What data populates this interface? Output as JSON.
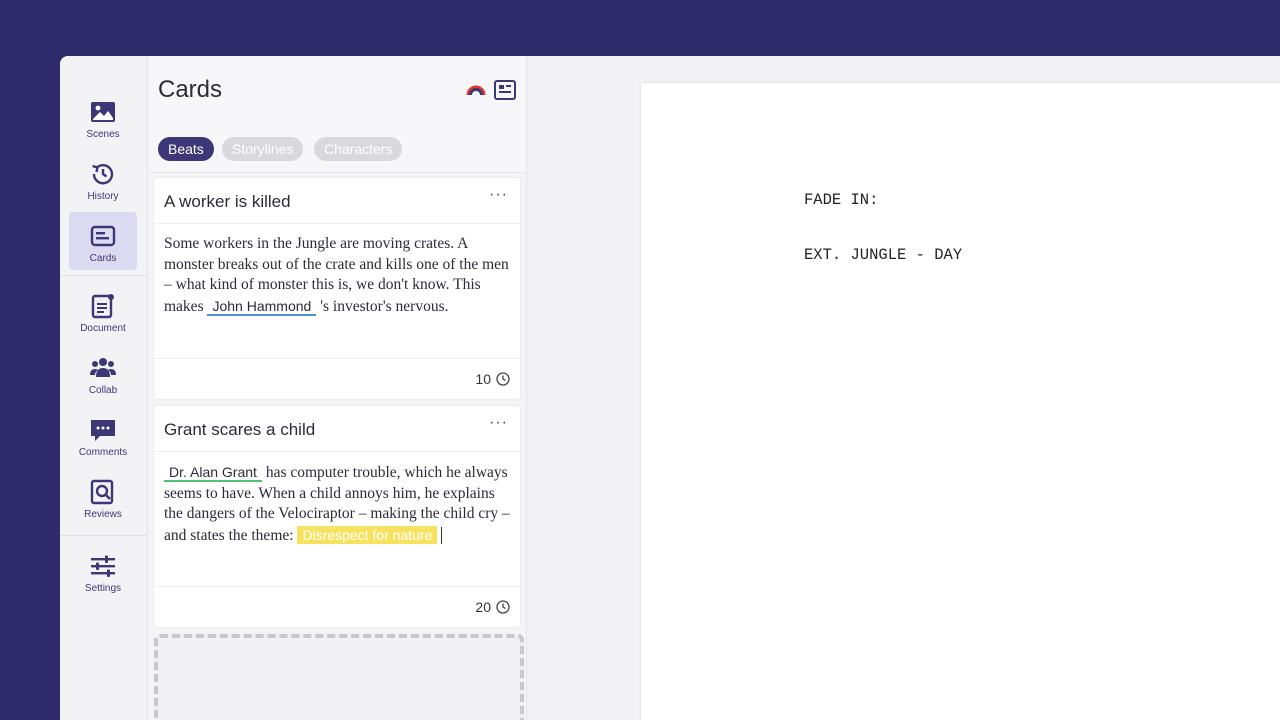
{
  "window": {
    "controls": [
      "close",
      "minimize",
      "zoom"
    ]
  },
  "sidebar": {
    "items": [
      {
        "label": "Scenes",
        "icon": "image-icon"
      },
      {
        "label": "History",
        "icon": "history-icon"
      },
      {
        "label": "Cards",
        "icon": "cards-icon",
        "active": true
      },
      {
        "label": "Document",
        "icon": "document-icon"
      },
      {
        "label": "Collab",
        "icon": "people-icon"
      },
      {
        "label": "Comments",
        "icon": "comment-icon"
      },
      {
        "label": "Reviews",
        "icon": "review-icon"
      },
      {
        "label": "Settings",
        "icon": "sliders-icon"
      }
    ]
  },
  "cards": {
    "title": "Cards",
    "filters": [
      "Beats",
      "Storylines",
      "Characters"
    ],
    "active_filter": "Beats",
    "items": [
      {
        "title": "A worker is killed",
        "menu": "···",
        "text_before": "Some workers in the Jungle are moving crates. A monster breaks out of the crate and kills one of the men – what kind of monster this is, we don't know. This makes ",
        "mention": "John Hammond",
        "text_after": " 's investor's nervous.",
        "duration": "10"
      },
      {
        "title": "Grant scares a child",
        "menu": "···",
        "mention": "Dr. Alan Grant",
        "text_after": " has computer trouble, which he always seems to have. When a child annoys him, he explains the dangers of the Velociraptor – making the child cry – and states the theme: ",
        "highlight": "Disrespect for nature",
        "duration": "20"
      }
    ]
  },
  "document": {
    "lines": [
      "FADE IN:",
      "EXT. JUNGLE - DAY"
    ]
  },
  "colors": {
    "background": "#2f2b6b",
    "accent": "#3c3777",
    "mention_blue": "#4a8fd8",
    "mention_green": "#53c07a",
    "highlight": "#f6e25f"
  }
}
